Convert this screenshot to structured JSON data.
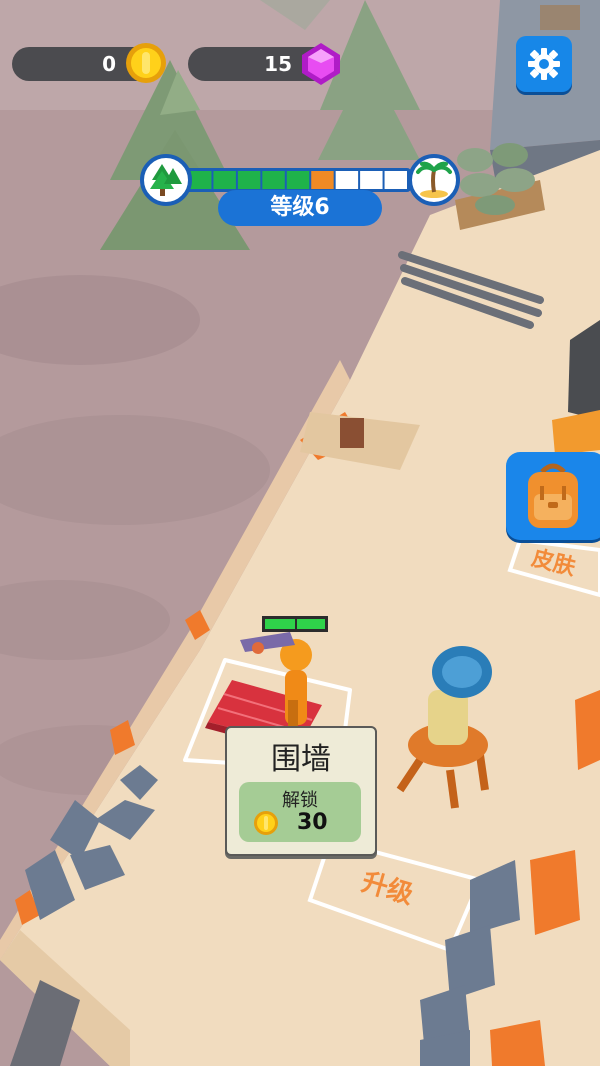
{
  "hud": {
    "coins": {
      "value": "0",
      "icon": "coin-icon"
    },
    "gems": {
      "value": "15",
      "icon": "gem-icon"
    },
    "settings": {
      "icon": "gear-icon"
    }
  },
  "progress": {
    "start_icon": "pine-tree-icon",
    "end_icon": "palm-tree-icon",
    "total_segments": 9,
    "completed_segments": 5,
    "current_segment": 6,
    "level_label": "等级6"
  },
  "side": {
    "backpack_icon": "backpack-icon"
  },
  "world": {
    "skin_zone_label": "皮肤",
    "upgrade_zone_label": "升级",
    "player_health": 1.0
  },
  "unlock_panel": {
    "title": "围墙",
    "action_label": "解锁",
    "cost": "30"
  },
  "colors": {
    "accent_blue": "#1787e8",
    "progress_done": "#1fb34a",
    "progress_current": "#f08a24",
    "zone_text": "#f28b3a"
  }
}
